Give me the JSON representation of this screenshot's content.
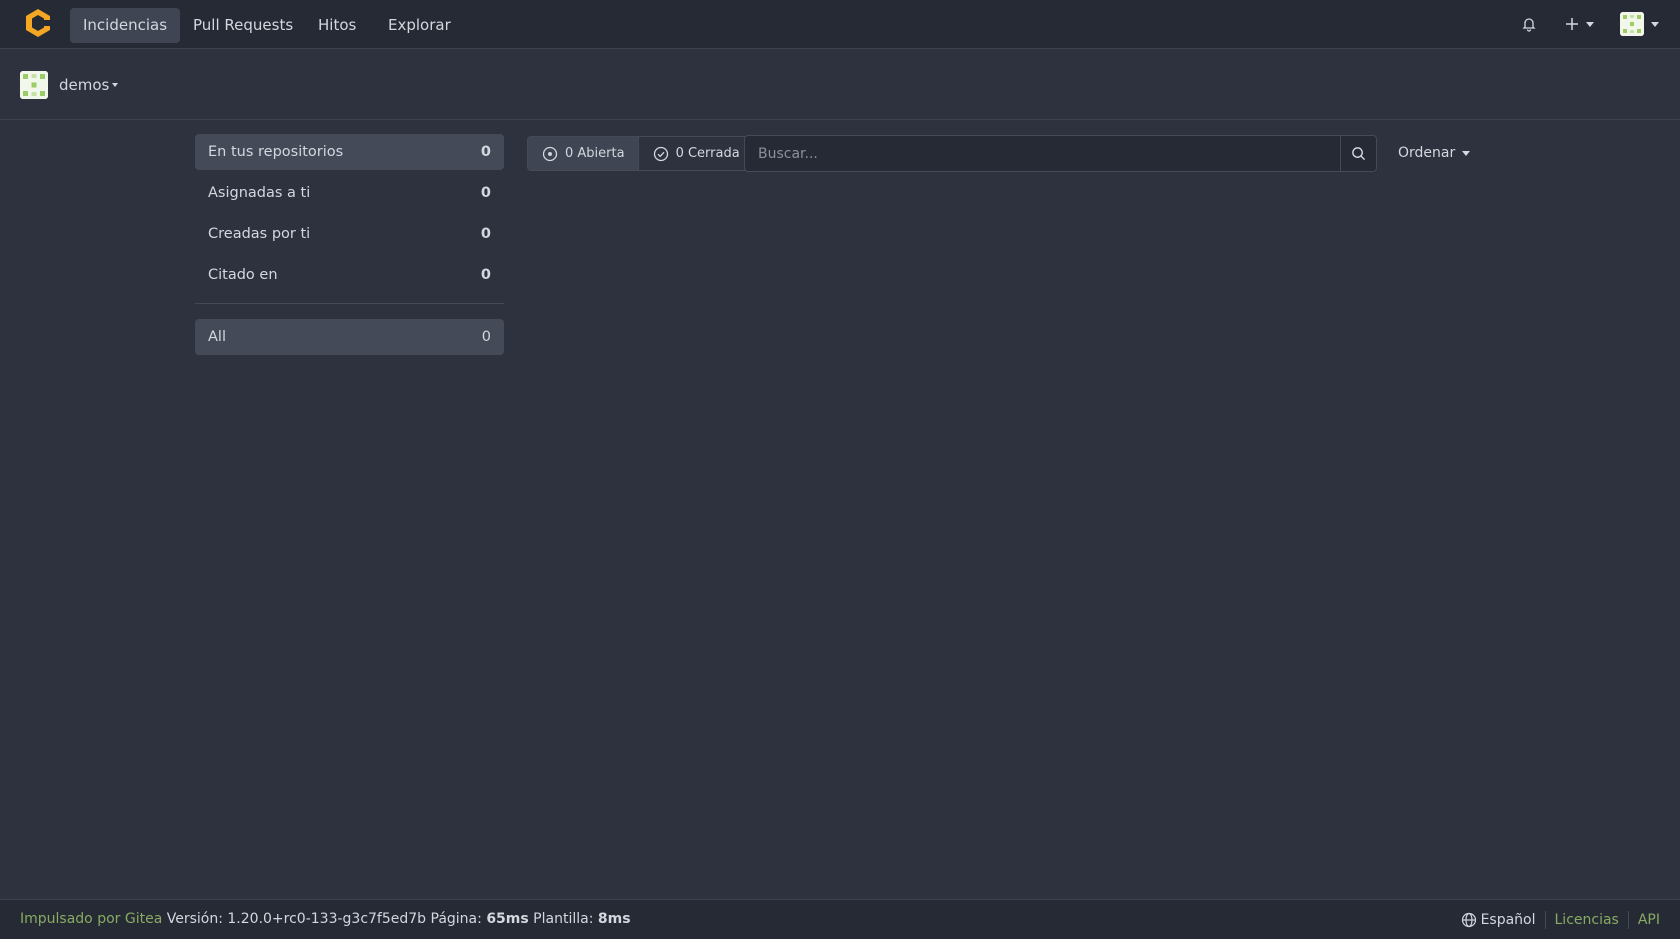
{
  "navbar": {
    "items": [
      {
        "label": "Incidencias",
        "active": true
      },
      {
        "label": "Pull Requests",
        "active": false
      },
      {
        "label": "Hitos",
        "active": false
      },
      {
        "label": "Explorar",
        "active": false
      }
    ],
    "icons": [
      "bell-icon",
      "plus-icon",
      "user-avatar"
    ]
  },
  "header": {
    "org_name": "demos"
  },
  "sidebar": {
    "items": [
      {
        "label": "En tus repositorios",
        "count": "0",
        "active": true
      },
      {
        "label": "Asignadas a ti",
        "count": "0",
        "active": false
      },
      {
        "label": "Creadas por ti",
        "count": "0",
        "active": false
      },
      {
        "label": "Citado en",
        "count": "0",
        "active": false
      }
    ],
    "all": {
      "label": "All",
      "count": "0",
      "active": true
    }
  },
  "filters": {
    "open_label": "0 Abierta",
    "closed_label": "0 Cerrada",
    "search_placeholder": "Buscar...",
    "search_value": "",
    "sort_label": "Ordenar"
  },
  "footer": {
    "powered_by": "Impulsado por Gitea",
    "version_label": "Versión:",
    "version": "1.20.0+rc0-133-g3c7f5ed7b",
    "page_label": "Página:",
    "page_time": "65ms",
    "template_label": "Plantilla:",
    "template_time": "8ms",
    "language": "Español",
    "licenses": "Licencias",
    "api": "API"
  },
  "colors": {
    "background": "#2e323e",
    "navbar": "#262a34",
    "accent_link": "#87ab63",
    "logo": "#f5a623"
  }
}
